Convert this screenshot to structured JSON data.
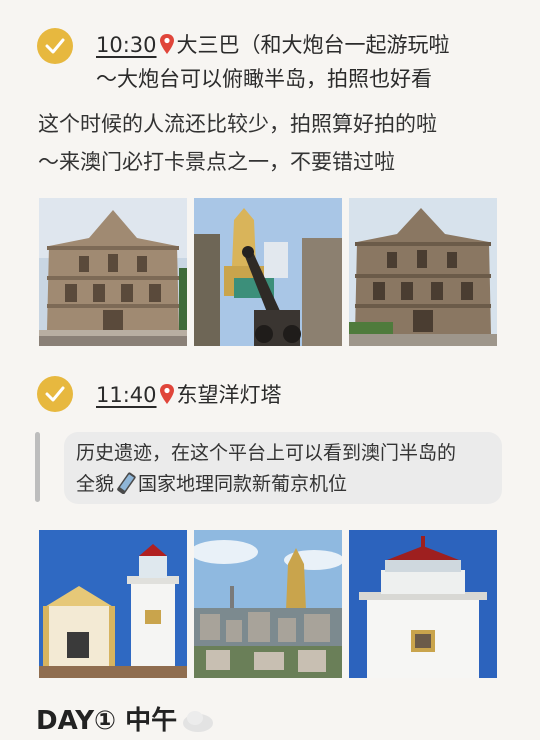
{
  "stop1": {
    "time": "10:30",
    "line1_rest": "大三巴（和大炮台一起游玩啦",
    "line2": "～大炮台可以俯瞰半岛，拍照也好看"
  },
  "paragraph": {
    "line1": "这个时候的人流还比较少，拍照算好拍的啦",
    "line2": "～来澳门必打卡景点之一，不要错过啦"
  },
  "stop2": {
    "time": "11:40",
    "place": "东望洋灯塔"
  },
  "quote": {
    "line1": "历史遗迹，在这个平台上可以看到澳门半岛的",
    "line2a": "全貌",
    "line2b": "国家地理同款新葡京机位"
  },
  "day_heading": "DAY① 中午",
  "icons": {
    "check": "check-circle-icon",
    "pin": "map-pin-icon",
    "phone": "phone-icon",
    "cloud": "cloud-icon"
  },
  "colors": {
    "check": "#e7b83f",
    "pin": "#e0453a"
  }
}
